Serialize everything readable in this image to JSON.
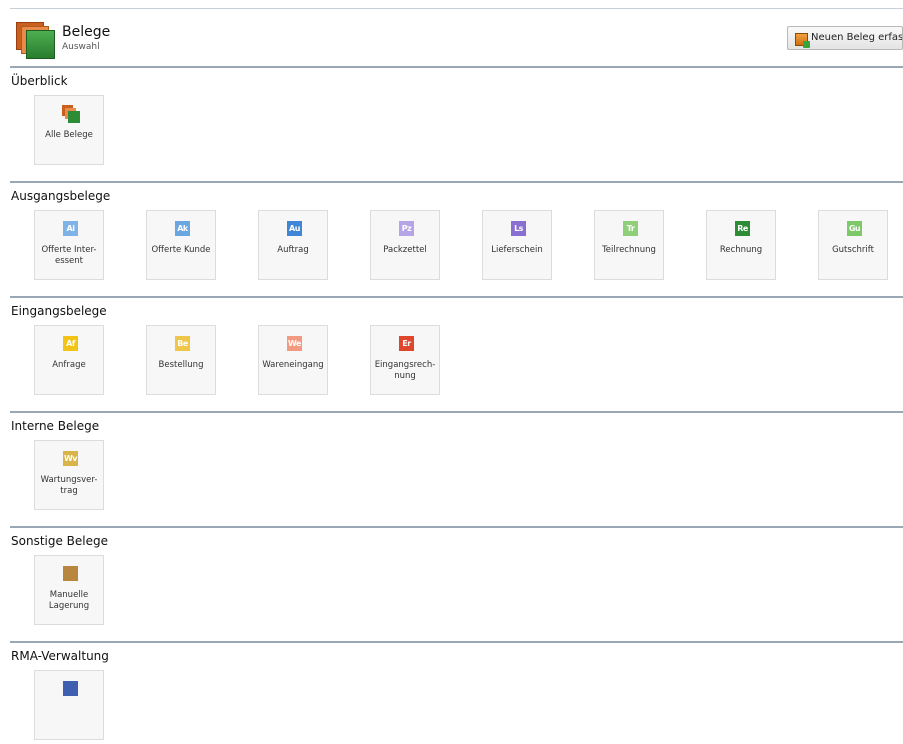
{
  "header": {
    "title": "Belege",
    "subtitle": "Auswahl",
    "new_button_label": "Neuen Beleg erfassen"
  },
  "sections": [
    {
      "title": "Überblick",
      "tiles": [
        {
          "label": "Alle Belege",
          "icon": "documents-stack-icon"
        }
      ]
    },
    {
      "title": "Ausgangsbelege",
      "tiles": [
        {
          "label": "Offerte Inter-\nessent",
          "abbr": "Ai",
          "color": "#7fb3e8"
        },
        {
          "label": "Offerte Kunde",
          "abbr": "Ak",
          "color": "#6aa6e0"
        },
        {
          "label": "Auftrag",
          "abbr": "Au",
          "color": "#3f86d6"
        },
        {
          "label": "Packzettel",
          "abbr": "Pz",
          "color": "#b6a5e6"
        },
        {
          "label": "Lieferschein",
          "abbr": "Ls",
          "color": "#8a6fd2"
        },
        {
          "label": "Teilrechnung",
          "abbr": "Tr",
          "color": "#8fcf7a"
        },
        {
          "label": "Rechnung",
          "abbr": "Re",
          "color": "#2e8b36"
        },
        {
          "label": "Gutschrift",
          "abbr": "Gu",
          "color": "#7ec86a"
        }
      ]
    },
    {
      "title": "Eingangsbelege",
      "tiles": [
        {
          "label": "Anfrage",
          "abbr": "Af",
          "color": "#f2c418"
        },
        {
          "label": "Bestellung",
          "abbr": "Be",
          "color": "#f0c64a"
        },
        {
          "label": "Wareneingang",
          "abbr": "We",
          "color": "#f29a80"
        },
        {
          "label": "Eingangsrech-\nnung",
          "abbr": "Er",
          "color": "#e0462c"
        }
      ]
    },
    {
      "title": "Interne Belege",
      "tiles": [
        {
          "label": "Wartungsver-\ntrag",
          "abbr": "Wv",
          "color": "#d9b44a"
        }
      ]
    },
    {
      "title": "Sonstige Belege",
      "tiles": [
        {
          "label": "Manuelle\nLagerung",
          "abbr": "",
          "color": "#b8863f"
        }
      ]
    },
    {
      "title": "RMA-Verwaltung",
      "tiles": [
        {
          "label": "",
          "abbr": "",
          "color": "#3f5fb0"
        }
      ]
    }
  ]
}
